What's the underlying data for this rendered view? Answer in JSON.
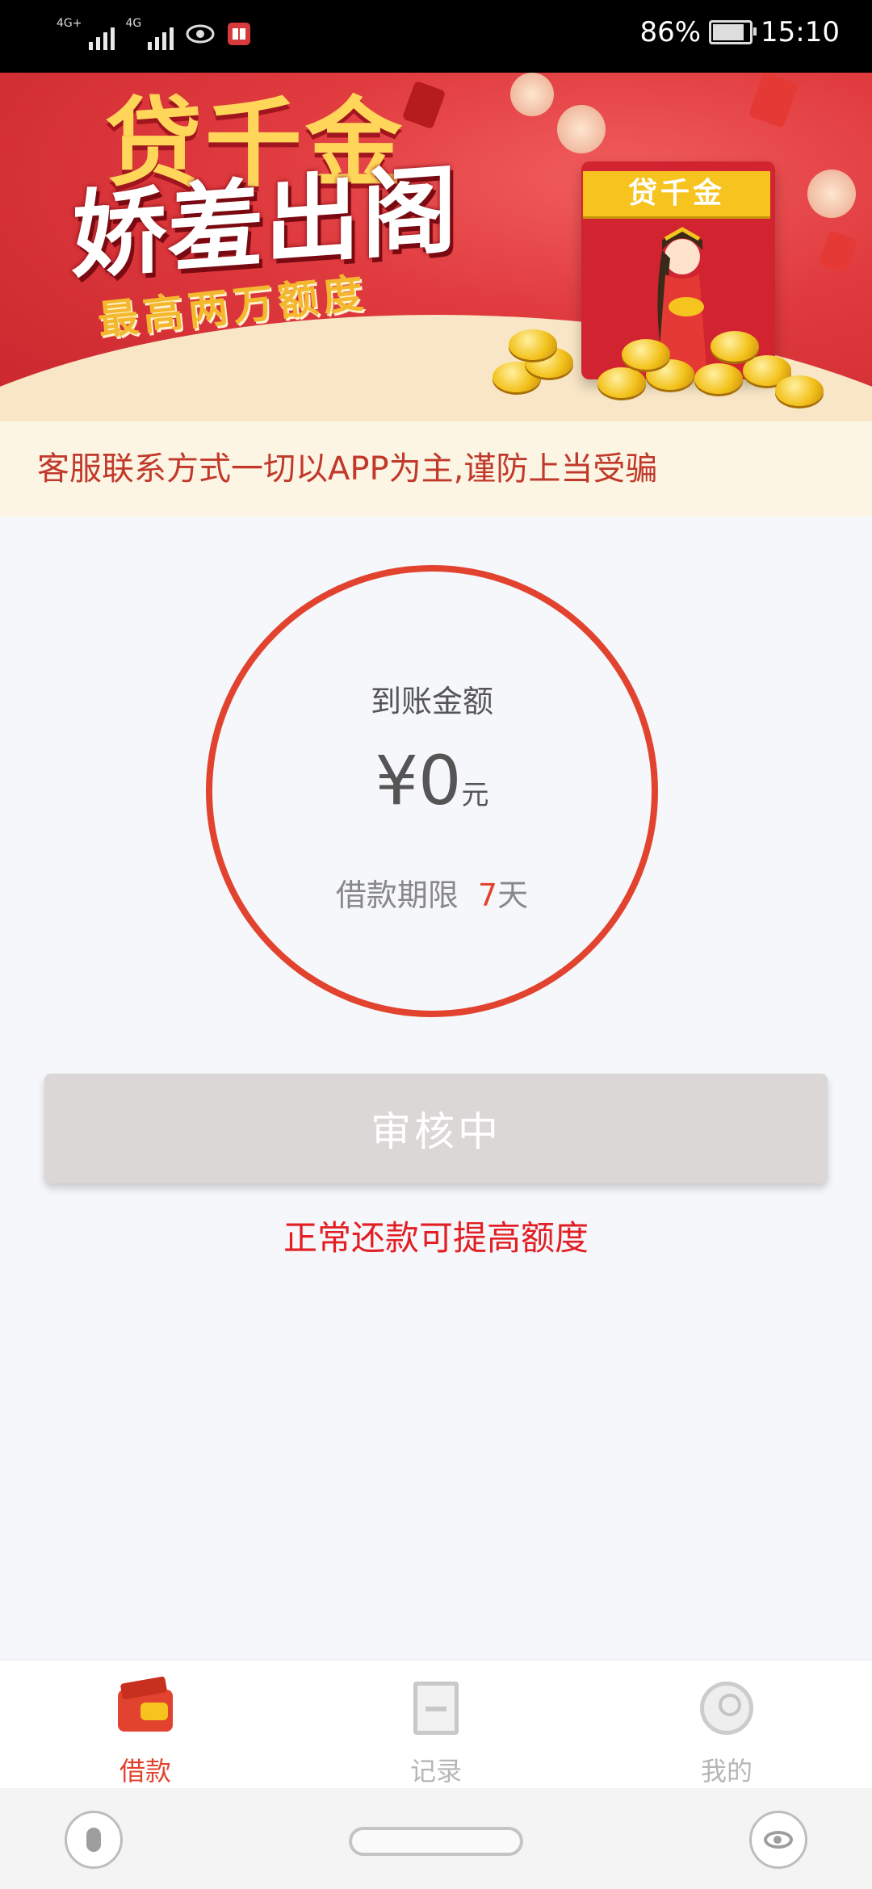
{
  "status_bar": {
    "network_1": "4G+",
    "network_2": "4G",
    "battery": "86%",
    "time": "15:10",
    "icons": [
      "signal-icon",
      "signal-icon",
      "eye-icon",
      "book-app-icon",
      "battery-icon"
    ]
  },
  "banner": {
    "title_top": "贷千金",
    "title_main": "娇羞出阁",
    "subtitle": "最高两万额度",
    "envelope_label": "贷千金",
    "colors": {
      "red": "#e03b3f",
      "gold": "#f7c31e",
      "cream": "#f8e6c6"
    }
  },
  "notice": "客服联系方式一切以APP为主,谨防上当受骗",
  "summary": {
    "title": "到账金额",
    "currency": "¥",
    "amount": "0",
    "unit": "元",
    "term_label": "借款期限",
    "term_days": "7",
    "term_unit": "天"
  },
  "status_button": "审核中",
  "hint": "正常还款可提高额度",
  "tabs": [
    {
      "label": "借款",
      "icon": "wallet-icon",
      "active": true
    },
    {
      "label": "记录",
      "icon": "receipt-icon",
      "active": false
    },
    {
      "label": "我的",
      "icon": "user-icon",
      "active": false
    }
  ],
  "nav_bar": {
    "icons": [
      "microphone-icon",
      "home-pill-icon",
      "eye-icon"
    ]
  },
  "colors": {
    "accent": "#e2432f",
    "hint": "#e31e24",
    "button_disabled": "#dad7d6",
    "background": "#f5f7fa"
  }
}
